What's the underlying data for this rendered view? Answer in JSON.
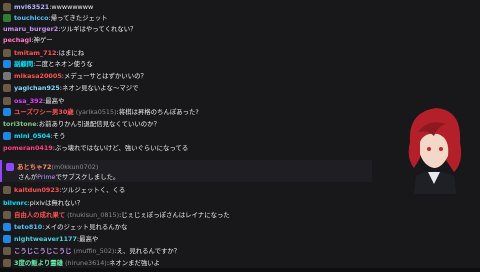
{
  "messages": [
    {
      "user": "mvl63521",
      "color": "#b5b5ff",
      "text": "wwwwwwww",
      "badge": "b-av"
    },
    {
      "user": "touchicco",
      "color": "#4fc3f7",
      "text": "帰ってきたジェット",
      "badge": "b-mod"
    },
    {
      "user": "umaru_burger2",
      "color": "#c792ea",
      "text": "ツルギはやってくれない？",
      "badge": ""
    },
    {
      "user": "pechagi",
      "color": "#ff79c6",
      "text": "神ゲー",
      "badge": ""
    },
    {
      "user": "tmitam_712",
      "color": "#ff5252",
      "text": "はまにね",
      "badge": "b-av"
    },
    {
      "user": "副顧問",
      "color": "#00e5ff",
      "text": "二度とネオン使うな",
      "badge": "b-sub"
    },
    {
      "user": "mikasa20005",
      "color": "#ff5252",
      "text": "メデューサとはずかいいの？",
      "badge": "b-sword"
    },
    {
      "user": "yagichan925",
      "color": "#80d8ff",
      "text": "ネオン見ないよな〜マジで",
      "badge": "b-av"
    },
    {
      "user": "osa_392",
      "color": "#e040fb",
      "text": "最高や",
      "badge": "b-av"
    },
    {
      "user": "ユーズワシー男30歳",
      "color": "#ff5252",
      "secondary": "(yarika0515)",
      "text": "将棋は昇格のちんぽあった?",
      "badge": "b-sub"
    },
    {
      "user": "tori3tone",
      "color": "#81c784",
      "text": "お前ありかん引退配信見なくていいのか？",
      "badge": ""
    },
    {
      "user": "mini_0504",
      "color": "#00e5ff",
      "text": "そう",
      "badge": "b-sub"
    },
    {
      "user": "pomeran0419",
      "color": "#ff4081",
      "text": "ぶっ壊れではないけど、強いぐらいになってる",
      "badge": ""
    },
    {
      "user": "kaitdun0923",
      "color": "#ff5252",
      "text": "ツルジェットく、くる",
      "badge": "b-av"
    },
    {
      "user": "bilvnrc",
      "color": "#00e5ff",
      "text": "pixivは無れない？",
      "badge": ""
    },
    {
      "user": "自由人の成れ果て",
      "color": "#ff5252",
      "secondary": "(tnukisun_0815)",
      "text": "じぇじぇぽっぽさんはレイナになった",
      "badge": "b-av"
    },
    {
      "user": "teto810",
      "color": "#4fc3f7",
      "text": "メイのジェット見れるんかな",
      "badge": "b-sub"
    },
    {
      "user": "nightweaver1177",
      "color": "#4dd0e1",
      "text": "最高や",
      "badge": "b-sub"
    },
    {
      "user": "こうじこうじこうじ",
      "color": "#c792ea",
      "secondary": "(muffin_502)",
      "text": "え、見れるんですか？",
      "badge": "b-av"
    },
    {
      "user": "3度の飯より霊雄",
      "color": "#69f0ae",
      "secondary": "(hirune3614)",
      "text": "ネオンまだ強いよ",
      "badge": "b-av"
    }
  ],
  "highlight": {
    "user": "あとちゃ72",
    "handle": "(m0kkun0702)",
    "pre": "さんが",
    "prime": "Prime",
    "post": "でサブスクしました。"
  },
  "colors": {
    "prime_accent": "#9147ff"
  }
}
